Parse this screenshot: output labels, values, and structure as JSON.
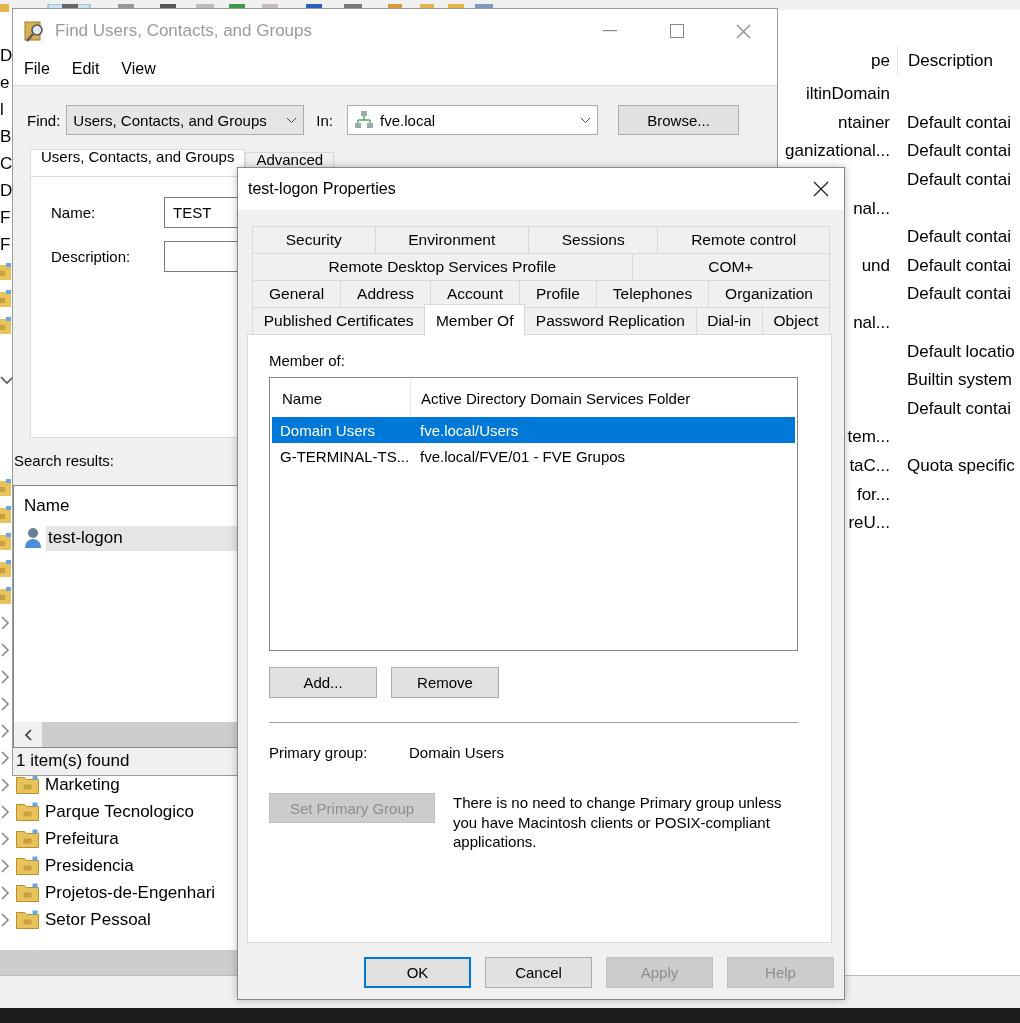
{
  "background_window": {
    "tree": [
      {
        "kind": "fragment",
        "label": "D"
      },
      {
        "kind": "fragment",
        "label": "e"
      },
      {
        "kind": "fragment",
        "label": "l"
      },
      {
        "kind": "fragment",
        "label": "B"
      },
      {
        "kind": "fragment",
        "label": "C"
      },
      {
        "kind": "fragment",
        "label": "D"
      },
      {
        "kind": "fragment",
        "label": "F"
      },
      {
        "kind": "fragment",
        "label": "F"
      },
      {
        "kind": "folder"
      },
      {
        "kind": "folder"
      },
      {
        "kind": "folder"
      },
      {
        "kind": "covered"
      },
      {
        "kind": "expanded"
      },
      {
        "kind": "covered"
      },
      {
        "kind": "covered"
      },
      {
        "kind": "covered"
      },
      {
        "kind": "folder"
      },
      {
        "kind": "folder"
      },
      {
        "kind": "folder"
      },
      {
        "kind": "folder"
      },
      {
        "kind": "folder"
      },
      {
        "kind": "collapsed"
      },
      {
        "kind": "collapsed"
      },
      {
        "kind": "collapsed"
      },
      {
        "kind": "collapsed"
      },
      {
        "kind": "collapsed"
      },
      {
        "kind": "collapsed"
      },
      {
        "kind": "item",
        "label": "Marketing"
      },
      {
        "kind": "item",
        "label": "Parque Tecnologico"
      },
      {
        "kind": "item",
        "label": "Prefeitura"
      },
      {
        "kind": "item",
        "label": "Presidencia"
      },
      {
        "kind": "item",
        "label": "Projetos-de-Engenhari"
      },
      {
        "kind": "item",
        "label": "Setor Pessoal"
      }
    ],
    "list": {
      "columns": [
        "pe",
        "Description"
      ],
      "rows": [
        {
          "type": "iltinDomain"
        },
        {
          "type": "ntainer",
          "description": "Default contai"
        },
        {
          "type": "ganizational...",
          "description": "Default contai"
        },
        {
          "description": "Default contai"
        },
        {
          "type": "nal..."
        },
        {
          "description": "Default contai"
        },
        {
          "type": "und",
          "description": "Default contai"
        },
        {
          "description": "Default contai"
        },
        {
          "type": "nal..."
        },
        {
          "description": "Default locatio"
        },
        {
          "description": "Builtin system"
        },
        {
          "description": "Default contai"
        },
        {
          "type": "tem..."
        },
        {
          "type": "taC...",
          "description": "Quota specific"
        },
        {
          "type": "for..."
        },
        {
          "type": "reU..."
        }
      ]
    }
  },
  "find_window": {
    "title": "Find Users, Contacts, and Groups",
    "active": false,
    "menu": [
      "File",
      "Edit",
      "View"
    ],
    "find_label": "Find:",
    "find_value": "Users, Contacts, and Groups",
    "in_label": "In:",
    "in_value": "fve.local",
    "browse": "Browse...",
    "tabs": [
      {
        "label": "Users, Contacts, and Groups",
        "selected": true
      },
      {
        "label": "Advanced",
        "selected": false
      }
    ],
    "fields": [
      {
        "label": "Name:",
        "value": "TEST"
      },
      {
        "label": "Description:"
      }
    ],
    "results_label": "Search results:",
    "results": {
      "columns": [
        "Name"
      ],
      "rows": [
        {
          "name": "test-logon",
          "selected": true
        }
      ]
    },
    "status": "1 item(s) found"
  },
  "properties_dialog": {
    "title": "test-logon Properties",
    "tab_rows": [
      [
        {
          "label": "Security",
          "selected": false
        },
        {
          "label": "Environment",
          "selected": false
        },
        {
          "label": "Sessions",
          "selected": false
        },
        {
          "label": "Remote control",
          "selected": false
        }
      ],
      [
        {
          "label": "Remote Desktop Services Profile",
          "selected": false
        },
        {
          "label": "COM+",
          "selected": false
        }
      ],
      [
        {
          "label": "General",
          "selected": false
        },
        {
          "label": "Address",
          "selected": false
        },
        {
          "label": "Account",
          "selected": false
        },
        {
          "label": "Profile",
          "selected": false
        },
        {
          "label": "Telephones",
          "selected": false
        },
        {
          "label": "Organization",
          "selected": false
        }
      ],
      [
        {
          "label": "Published Certificates",
          "selected": false
        },
        {
          "label": "Member Of",
          "selected": true
        },
        {
          "label": "Password Replication",
          "selected": false
        },
        {
          "label": "Dial-in",
          "selected": false
        },
        {
          "label": "Object",
          "selected": false
        }
      ]
    ],
    "member_of_label": "Member of:",
    "columns": [
      "Name",
      "Active Directory Domain Services Folder"
    ],
    "rows": [
      {
        "name": "Domain Users",
        "folder": "fve.local/Users",
        "selected": true
      },
      {
        "name": "G-TERMINAL-TS...",
        "folder": "fve.local/FVE/01 - FVE Grupos",
        "selected": false
      }
    ],
    "add": "Add...",
    "remove": "Remove",
    "primary_label": "Primary group:",
    "primary_value": "Domain Users",
    "set_primary": {
      "label": "Set Primary Group",
      "disabled": true
    },
    "note": "There is no need to change Primary group unless you have Macintosh clients or POSIX-compliant applications.",
    "buttons": [
      {
        "label": "OK",
        "default": true,
        "disabled": false
      },
      {
        "label": "Cancel",
        "default": false,
        "disabled": false
      },
      {
        "label": "Apply",
        "default": false,
        "disabled": true
      },
      {
        "label": "Help",
        "default": false,
        "disabled": true
      }
    ]
  }
}
